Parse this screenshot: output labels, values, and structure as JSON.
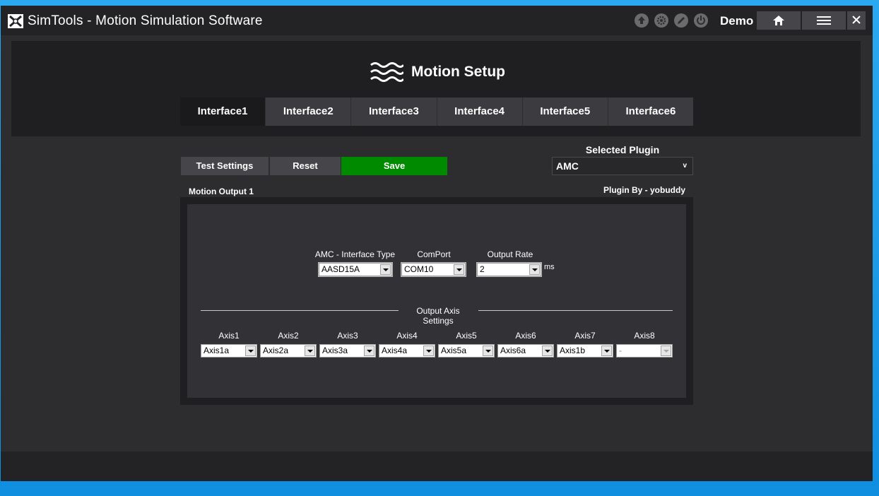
{
  "titlebar": {
    "logo_name": "simtools-logo",
    "title": "SimTools - Motion Simulation Software",
    "icons": [
      "arrow-up-icon",
      "gear-icon",
      "pencil-icon",
      "power-icon"
    ],
    "demo_label": "Demo",
    "home_icon": "home-icon",
    "menu_icon": "hamburger-menu-icon",
    "close_icon": "close-icon"
  },
  "header": {
    "title": "Motion Setup",
    "icon": "waves-icon"
  },
  "tabs": [
    {
      "label": "Interface1",
      "active": true
    },
    {
      "label": "Interface2",
      "active": false
    },
    {
      "label": "Interface3",
      "active": false
    },
    {
      "label": "Interface4",
      "active": false
    },
    {
      "label": "Interface5",
      "active": false
    },
    {
      "label": "Interface6",
      "active": false
    }
  ],
  "actions": {
    "test_settings": "Test Settings",
    "reset": "Reset",
    "save": "Save"
  },
  "plugin": {
    "label": "Selected Plugin",
    "selected": "AMC",
    "caret": "v",
    "author": "Plugin By - yobuddy"
  },
  "motion_output": {
    "label": "Motion Output 1",
    "interface_type": {
      "label": "AMC - Interface Type",
      "value": "AASD15A"
    },
    "comport": {
      "label": "ComPort",
      "value": "COM10"
    },
    "output_rate": {
      "label": "Output Rate",
      "value": "2",
      "unit": "ms"
    },
    "axis_section_title": "Output Axis Settings",
    "axes": [
      {
        "label": "Axis1",
        "value": "Axis1a",
        "enabled": true
      },
      {
        "label": "Axis2",
        "value": "Axis2a",
        "enabled": true
      },
      {
        "label": "Axis3",
        "value": "Axis3a",
        "enabled": true
      },
      {
        "label": "Axis4",
        "value": "Axis4a",
        "enabled": true
      },
      {
        "label": "Axis5",
        "value": "Axis5a",
        "enabled": true
      },
      {
        "label": "Axis6",
        "value": "Axis6a",
        "enabled": true
      },
      {
        "label": "Axis7",
        "value": "Axis1b",
        "enabled": true
      },
      {
        "label": "Axis8",
        "value": "-",
        "enabled": false
      }
    ]
  },
  "colors": {
    "save_green": "#008a00",
    "button_gray": "#46464a",
    "panel_dark": "#1f1f22",
    "window_bg": "#2d2d30",
    "desktop_blue": "#1a9ae6"
  }
}
